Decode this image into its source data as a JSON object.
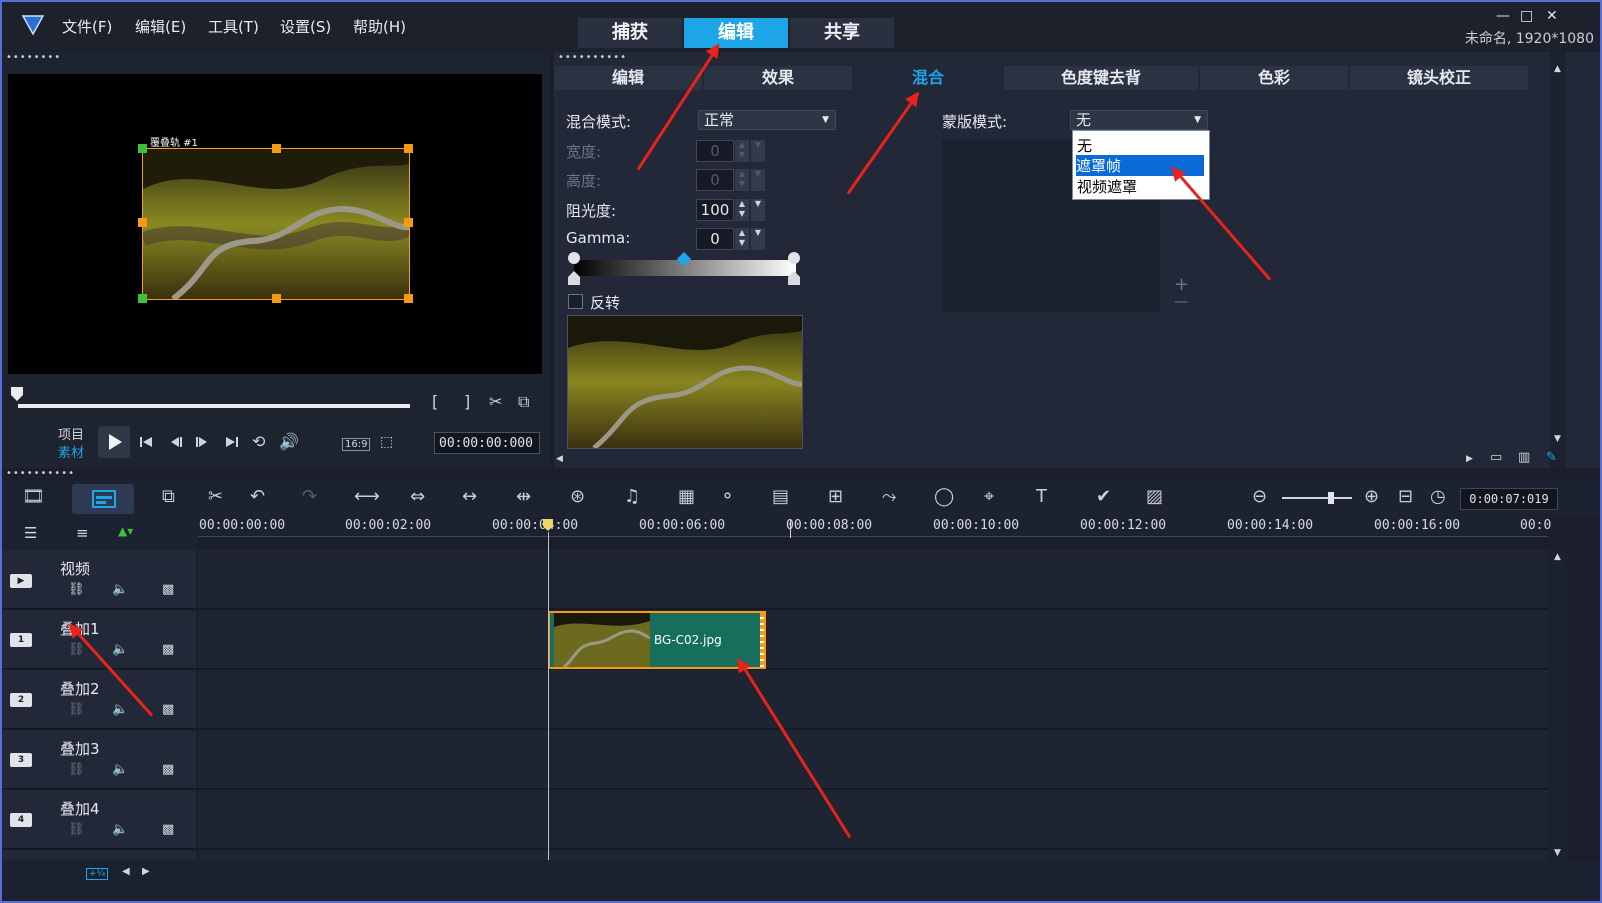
{
  "menu": [
    "文件(F)",
    "编辑(E)",
    "工具(T)",
    "设置(S)",
    "帮助(H)"
  ],
  "main_tabs": [
    "捕获",
    "编辑",
    "共享"
  ],
  "window_controls": [
    "—",
    "□",
    "✕"
  ],
  "project_info": "未命名, 1920*1080",
  "preview": {
    "overlay_label": "覆叠轨 #1",
    "mode_project": "项目",
    "mode_clip": "素材",
    "aspect": "16:9",
    "timecode": "00:00:00:000"
  },
  "option_tabs": [
    "编辑",
    "效果",
    "混合",
    "色度键去背",
    "色彩",
    "镜头校正"
  ],
  "blend": {
    "blend_mode_label": "混合模式:",
    "blend_mode_value": "正常",
    "width_label": "宽度:",
    "width_value": "0",
    "height_label": "高度:",
    "height_value": "0",
    "opacity_label": "阻光度:",
    "opacity_value": "100",
    "gamma_label": "Gamma:",
    "gamma_value": "0",
    "invert_label": "反转",
    "mask_mode_label": "蒙版模式:",
    "mask_mode_value": "无",
    "mask_options": [
      "无",
      "遮罩帧",
      "视频遮罩"
    ],
    "mask_selected": "遮罩帧",
    "plus": "+",
    "minus": "—"
  },
  "timeline": {
    "time_display": "0:00:07:019",
    "ruler": [
      "00:00:00:00",
      "00:00:02:00",
      "00:00:04:00",
      "00:00:06:00",
      "00:00:08:00",
      "00:00:10:00",
      "00:00:12:00",
      "00:00:14:00",
      "00:00:16:00",
      "00:0"
    ],
    "tracks": [
      {
        "name": "视频",
        "icon": "▶"
      },
      {
        "name": "叠加1",
        "icon": "1"
      },
      {
        "name": "叠加2",
        "icon": "2"
      },
      {
        "name": "叠加3",
        "icon": "3"
      },
      {
        "name": "叠加4",
        "icon": "4"
      }
    ],
    "clip_name": "BG-C02.jpg"
  },
  "colors": {
    "accent": "#1da5e8",
    "handle": "#f59a12",
    "arrow": "#e8231b",
    "clip": "#166e5c"
  }
}
